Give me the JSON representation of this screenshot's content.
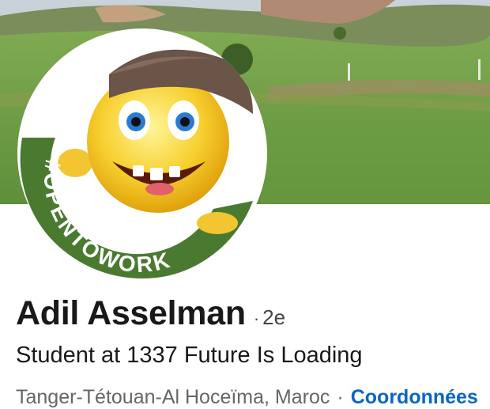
{
  "profile": {
    "name": "Adil Asselman",
    "separator": "·",
    "connection_degree": "2e",
    "headline": "Student at 1337 Future Is Loading",
    "location": "Tanger-Tétouan-Al Hoceïma, Maroc",
    "location_separator": "·",
    "contact_link": "Coordonnées"
  },
  "avatar": {
    "frame_badge": "#OPENTOWORK",
    "frame_color": "#4a7a30",
    "image": "emoji-with-cap-icon"
  },
  "cover": {
    "image": "green-fields-landscape"
  },
  "colors": {
    "link": "#0a66c2",
    "text": "#191919",
    "muted": "#666666"
  }
}
